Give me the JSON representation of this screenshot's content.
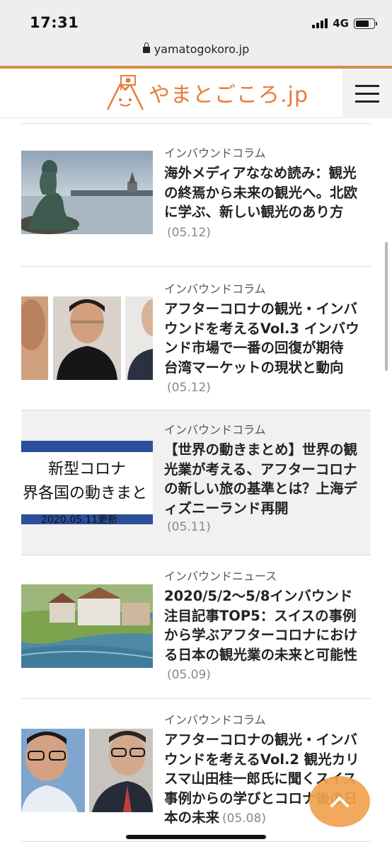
{
  "status": {
    "time": "17:31",
    "network": "4G",
    "battery_level": 0.75
  },
  "browser": {
    "url": "yamatogokoro.jp"
  },
  "header": {
    "logo_text": "やまとごころ.jp",
    "menu_icon": "hamburger-menu-icon",
    "accent_color": "#d98b46",
    "brand_color": "#e87b3a"
  },
  "thumb_text": {
    "line1": "新型コロナ",
    "line2": "界各国の動きまと",
    "line3": "2020.05.11更新"
  },
  "articles": [
    {
      "category": "インバウンドコラム",
      "title": "海外メディアななめ読み：観光の終焉から未来の観光へ。北欧に学ぶ、新しい観光のあり方",
      "date": "(05.12)",
      "thumbnail": "mermaid-statue-photo"
    },
    {
      "category": "インバウンドコラム",
      "title": "アフターコロナの観光・インバウンドを考えるVol.3 インバウンド市場で一番の回復が期待 台湾マーケットの現状と動向",
      "date": "(05.12)",
      "thumbnail": "speakers-photo"
    },
    {
      "category": "インバウンドコラム",
      "title": "【世界の動きまとめ】世界の観光業が考える、アフターコロナの新しい旅の基準とは？上海ディズニーランド再開",
      "date": "(05.11)",
      "thumbnail": "corona-world-banner"
    },
    {
      "category": "インバウンドニュース",
      "title": "2020/5/2〜5/8インバウンド注目記事TOP5：スイスの事例から学ぶアフターコロナにおける日本の観光業の未来と可能性",
      "date": "(05.09)",
      "thumbnail": "swiss-river-town-photo"
    },
    {
      "category": "インバウンドコラム",
      "title": "アフターコロナの観光・インバウンドを考えるVol.2 観光カリスマ山田桂一郎氏に聞くスイス事例からの学びとコロナ後の日本の未来",
      "date": "(05.08)",
      "thumbnail": "speakers-photo-2"
    }
  ],
  "back_to_top_icon": "chevron-up-icon"
}
